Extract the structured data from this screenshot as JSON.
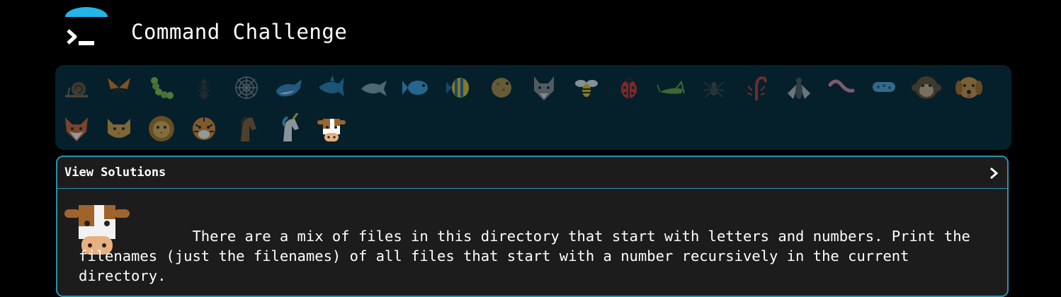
{
  "header": {
    "title": "Command Challenge"
  },
  "animals": [
    {
      "name": "snail"
    },
    {
      "name": "butterfly"
    },
    {
      "name": "caterpillar"
    },
    {
      "name": "ant"
    },
    {
      "name": "spider-web"
    },
    {
      "name": "whale"
    },
    {
      "name": "shark"
    },
    {
      "name": "dolphin"
    },
    {
      "name": "fish"
    },
    {
      "name": "tropical-fish"
    },
    {
      "name": "blowfish"
    },
    {
      "name": "wolf"
    },
    {
      "name": "bee"
    },
    {
      "name": "ladybug"
    },
    {
      "name": "cricket"
    },
    {
      "name": "spider"
    },
    {
      "name": "scorpion"
    },
    {
      "name": "fly"
    },
    {
      "name": "worm"
    },
    {
      "name": "microbe"
    },
    {
      "name": "monkey"
    },
    {
      "name": "dog"
    },
    {
      "name": "fox"
    },
    {
      "name": "cat"
    },
    {
      "name": "lion"
    },
    {
      "name": "tiger"
    },
    {
      "name": "horse"
    },
    {
      "name": "unicorn"
    },
    {
      "name": "cow",
      "active": true
    }
  ],
  "panel": {
    "title": "View Solutions",
    "description_indent": "             ",
    "description": "There are a mix of files in this directory that start with letters and numbers. Print the filenames (just the filenames) of all files that start with a number recursively in the current directory."
  },
  "colors": {
    "accent": "#2e8fb0",
    "bar_bg": "#06202b",
    "panel_bg": "#1c1c1c",
    "logo_cap": "#22b5e8"
  }
}
